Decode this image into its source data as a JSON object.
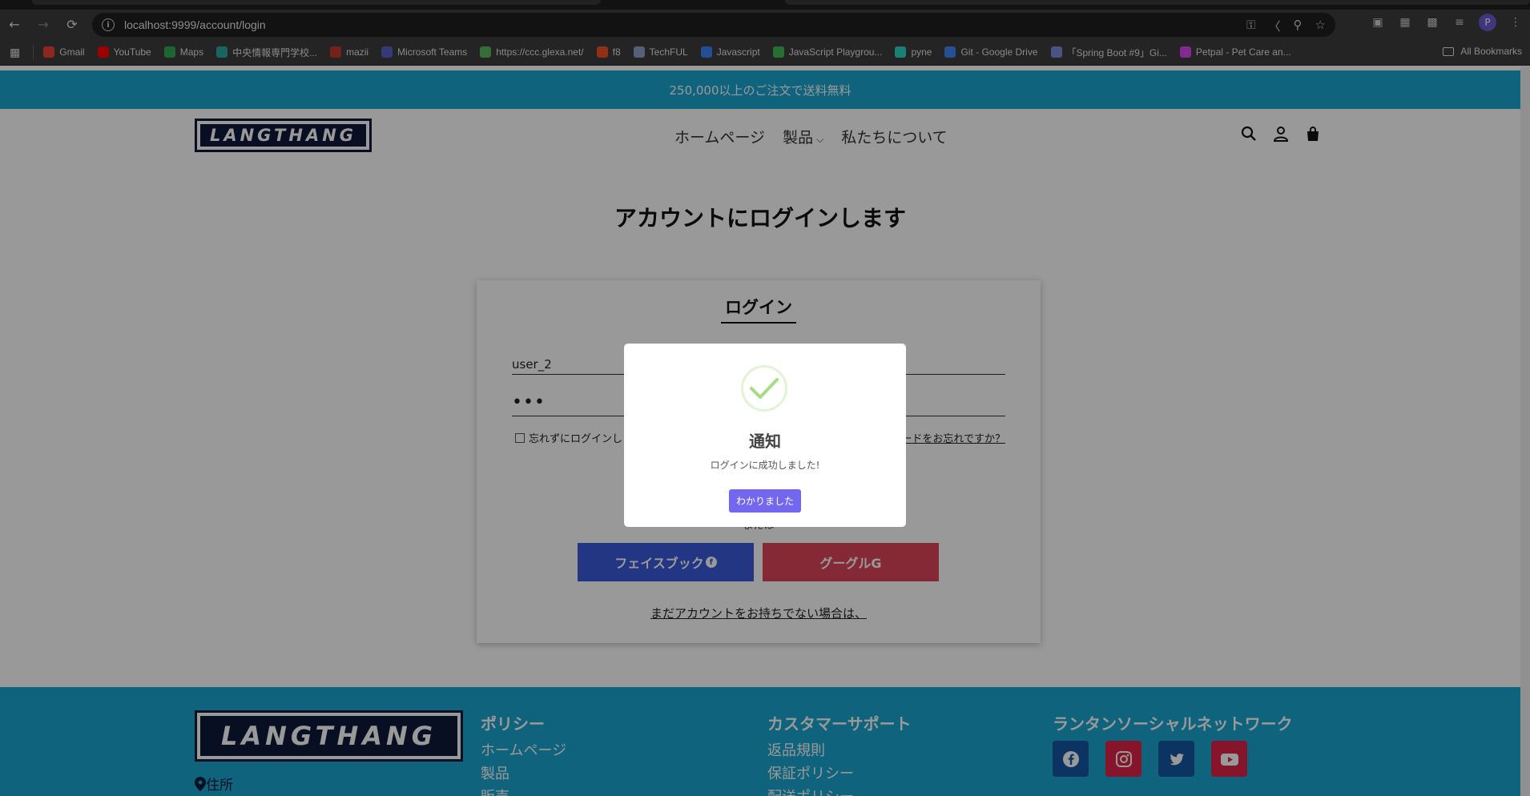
{
  "browser": {
    "url": "localhost:9999/account/login",
    "bookmarks": [
      {
        "label": "Gmail",
        "color": "#ea4335"
      },
      {
        "label": "YouTube",
        "color": "#ff0000"
      },
      {
        "label": "Maps",
        "color": "#34a853"
      },
      {
        "label": "中央情報専門学校...",
        "color": "#2aa7a0"
      },
      {
        "label": "mazii",
        "color": "#c0392b"
      },
      {
        "label": "Microsoft Teams",
        "color": "#5b5fc7"
      },
      {
        "label": "https://ccc.glexa.net/",
        "color": "#5cb85c"
      },
      {
        "label": "f8",
        "color": "#f05123"
      },
      {
        "label": "TechFUL",
        "color": "#8aa0c8"
      },
      {
        "label": "Javascript",
        "color": "#3b82f6"
      },
      {
        "label": "JavaScript Playgrou...",
        "color": "#3fb950"
      },
      {
        "label": "pyne",
        "color": "#2dd4bf"
      },
      {
        "label": "Git - Google Drive",
        "color": "#4285f4"
      },
      {
        "label": "「Spring Boot #9」Gi...",
        "color": "#7c8bd8"
      },
      {
        "label": "Petpal - Pet Care an...",
        "color": "#d946ef"
      }
    ],
    "all_bookmarks": "All Bookmarks",
    "profile_initial": "P"
  },
  "site": {
    "announcement": "250,000以上のご注文で送料無料",
    "logo_text": "LANGTHANG",
    "nav": {
      "home": "ホームページ",
      "products": "製品",
      "about": "私たちについて"
    }
  },
  "login": {
    "page_title": "アカウントにログインします",
    "card_title": "ログイン",
    "username_value": "user_2",
    "password_value": "•••",
    "remember_label": "忘れずにログインし",
    "forgot_label": "ードをお忘れですか？",
    "or_text": "または",
    "facebook_label": "フェイスブック",
    "google_label": "グーグルG",
    "register_link": "まだアカウントをお持ちでない場合は、"
  },
  "footer": {
    "address": "住所",
    "policy": {
      "heading": "ポリシー",
      "links": [
        "ホームページ",
        "製品",
        "販売"
      ]
    },
    "support": {
      "heading": "カスタマーサポート",
      "links": [
        "返品規則",
        "保証ポリシー",
        "配送ポリシー"
      ]
    },
    "social": {
      "heading": "ランタンソーシャルネットワーク"
    }
  },
  "modal": {
    "title": "通知",
    "message": "ログインに成功しました!",
    "ok_label": "わかりました",
    "check_color": "#a5dc86",
    "button_color": "#7367f0"
  }
}
